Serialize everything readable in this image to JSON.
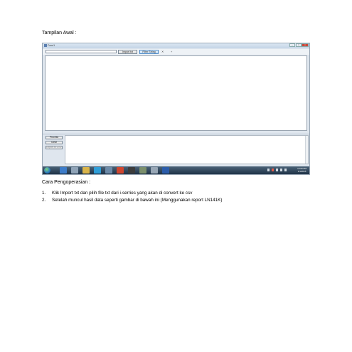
{
  "document": {
    "heading_initial": "Tampilan Awal :",
    "heading_operation": "Cara Pengoperasian  :",
    "steps": [
      {
        "number": "1.",
        "text": "Klik Import txt dan pilih file txt dari i-serries yang akan di convert ke csv"
      },
      {
        "number": "2.",
        "text": "Setelah muncul hasil data seperti gambar di bawah ini (Menggunakan report LN141K)"
      }
    ]
  },
  "screenshot": {
    "window_title": "Form1",
    "toolbar": {
      "import_label": "Import txt",
      "filter_label": "Filter String",
      "x_glyph": "✕",
      "plus_glyph": "+"
    },
    "side_buttons": {
      "process_label": "Process",
      "clear_label": "Clear",
      "export_label": "Export to CSV"
    },
    "taskbar": {
      "clock_time": "12:00 PM",
      "clock_date": "1/1/2015"
    }
  },
  "colors": {
    "taskbar": "#1f3347",
    "window_frame": "#dfe6ee",
    "accent_button": "#c6e0f7"
  }
}
